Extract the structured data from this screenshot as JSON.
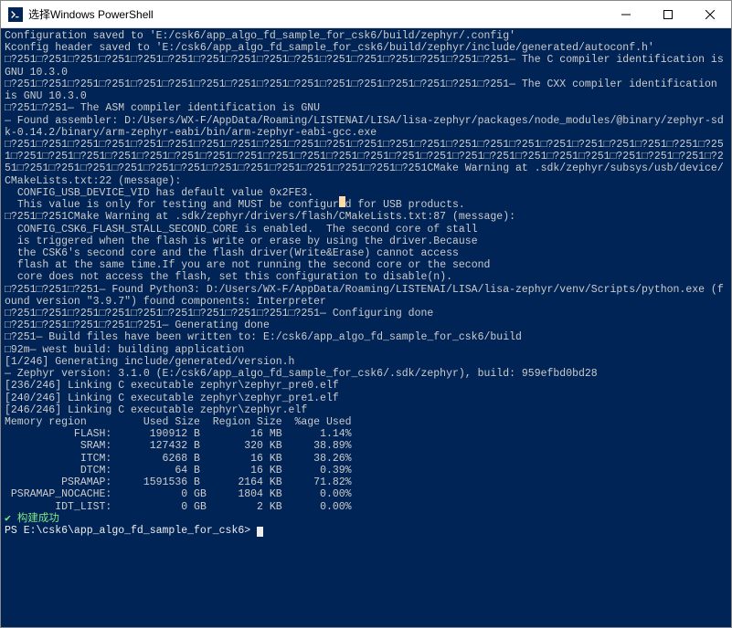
{
  "window": {
    "title": "选择Windows PowerShell",
    "icon_label": "PS"
  },
  "terminal": {
    "lines": [
      {
        "cls": "term-line",
        "text": "Configuration saved to 'E:/csk6/app_algo_fd_sample_for_csk6/build/zephyr/.config'"
      },
      {
        "cls": "term-line",
        "text": "Kconfig header saved to 'E:/csk6/app_algo_fd_sample_for_csk6/build/zephyr/include/generated/autoconf.h'"
      },
      {
        "cls": "term-line",
        "text": "□?251□?251□?251□?251□?251□?251□?251□?251□?251□?251□?251□?251□?251□?251□?251□?251— The C compiler identification is GNU 10.3.0"
      },
      {
        "cls": "term-line",
        "text": "□?251□?251□?251□?251□?251□?251□?251□?251□?251□?251□?251□?251□?251□?251□?251□?251— The CXX compiler identification is GNU 10.3.0"
      },
      {
        "cls": "term-line",
        "text": "□?251□?251— The ASM compiler identification is GNU"
      },
      {
        "cls": "term-line",
        "text": "— Found assembler: D:/Users/WX-F/AppData/Roaming/LISTENAI/LISA/lisa-zephyr/packages/node_modules/@binary/zephyr-sdk-0.14.2/binary/arm-zephyr-eabi/bin/arm-zephyr-eabi-gcc.exe"
      },
      {
        "cls": "term-line",
        "text": "□?251□?251□?251□?251□?251□?251□?251□?251□?251□?251□?251□?251□?251□?251□?251□?251□?251□?251□?251□?251□?251□?251□?251□?251□?251□?251□?251□?251□?251□?251□?251□?251□?251□?251□?251□?251□?251□?251□?251□?251□?251□?251□?251□?251□?251□?251□?251□?251□?251□?251□?251□?251□?251□?251□?251□?251□?251□?251□?251CMake Warning at .sdk/zephyr/subsys/usb/device/CMakeLists.txt:22 (message):"
      },
      {
        "cls": "term-line highlight",
        "text": "  CONFIG_USB_DEVICE_VID has default value 0x2FE3."
      },
      {
        "cls": "term-line",
        "text": ""
      },
      {
        "cls": "term-line",
        "text": "  This value is only for testing and MUST be configured for USB products."
      },
      {
        "cls": "term-line",
        "text": ""
      },
      {
        "cls": "term-line",
        "text": ""
      },
      {
        "cls": "term-line",
        "text": "□?251□?251CMake Warning at .sdk/zephyr/drivers/flash/CMakeLists.txt:87 (message):"
      },
      {
        "cls": "term-line",
        "text": "  CONFIG_CSK6_FLASH_STALL_SECOND_CORE is enabled.  The second core of stall"
      },
      {
        "cls": "term-line",
        "text": "  is triggered when the flash is write or erase by using the driver.Because"
      },
      {
        "cls": "term-line",
        "text": "  the CSK6's second core and the flash driver(Write&Erase) cannot access"
      },
      {
        "cls": "term-line",
        "text": "  flash at the same time.If you are not running the second core or the second"
      },
      {
        "cls": "term-line",
        "text": "  core does not access the flash, set this configuration to disable(n)."
      },
      {
        "cls": "term-line",
        "text": ""
      },
      {
        "cls": "term-line",
        "text": ""
      },
      {
        "cls": "term-line",
        "text": "□?251□?251□?251— Found Python3: D:/Users/WX-F/AppData/Roaming/LISTENAI/LISA/lisa-zephyr/venv/Scripts/python.exe (found version \"3.9.7\") found components: Interpreter"
      },
      {
        "cls": "term-line",
        "text": "□?251□?251□?251□?251□?251□?251□?251□?251□?251□?251— Configuring done"
      },
      {
        "cls": "term-line",
        "text": "□?251□?251□?251□?251□?251— Generating done"
      },
      {
        "cls": "term-line",
        "text": "□?251— Build files have been written to: E:/csk6/app_algo_fd_sample_for_csk6/build"
      },
      {
        "cls": "term-line",
        "text": "□92m— west build: building application"
      },
      {
        "cls": "term-line",
        "text": "[1/246] Generating include/generated/version.h"
      },
      {
        "cls": "term-line",
        "text": "— Zephyr version: 3.1.0 (E:/csk6/app_algo_fd_sample_for_csk6/.sdk/zephyr), build: 959efbd0bd28"
      },
      {
        "cls": "term-line",
        "text": "[236/246] Linking C executable zephyr\\zephyr_pre0.elf"
      },
      {
        "cls": "term-line",
        "text": ""
      },
      {
        "cls": "term-line",
        "text": "[240/246] Linking C executable zephyr\\zephyr_pre1.elf"
      },
      {
        "cls": "term-line",
        "text": ""
      },
      {
        "cls": "term-line",
        "text": "[246/246] Linking C executable zephyr\\zephyr.elf"
      },
      {
        "cls": "term-line",
        "text": "Memory region         Used Size  Region Size  %age Used"
      },
      {
        "cls": "term-line",
        "text": "           FLASH:      190912 B        16 MB      1.14%"
      },
      {
        "cls": "term-line",
        "text": "            SRAM:      127432 B       320 KB     38.89%"
      },
      {
        "cls": "term-line",
        "text": "            ITCM:        6268 B        16 KB     38.26%"
      },
      {
        "cls": "term-line",
        "text": "            DTCM:          64 B        16 KB      0.39%"
      },
      {
        "cls": "term-line",
        "text": "         PSRAMAP:     1591536 B      2164 KB     71.82%"
      },
      {
        "cls": "term-line",
        "text": " PSRAMAP_NOCACHE:           0 GB     1804 KB      0.00%"
      },
      {
        "cls": "term-line",
        "text": "        IDT_LIST:           0 GB        2 KB      0.00%"
      },
      {
        "cls": "term-green",
        "text": "✔ 构建成功"
      },
      {
        "cls": "term-white prompt",
        "text": "PS E:\\csk6\\app_algo_fd_sample_for_csk6> "
      }
    ]
  }
}
